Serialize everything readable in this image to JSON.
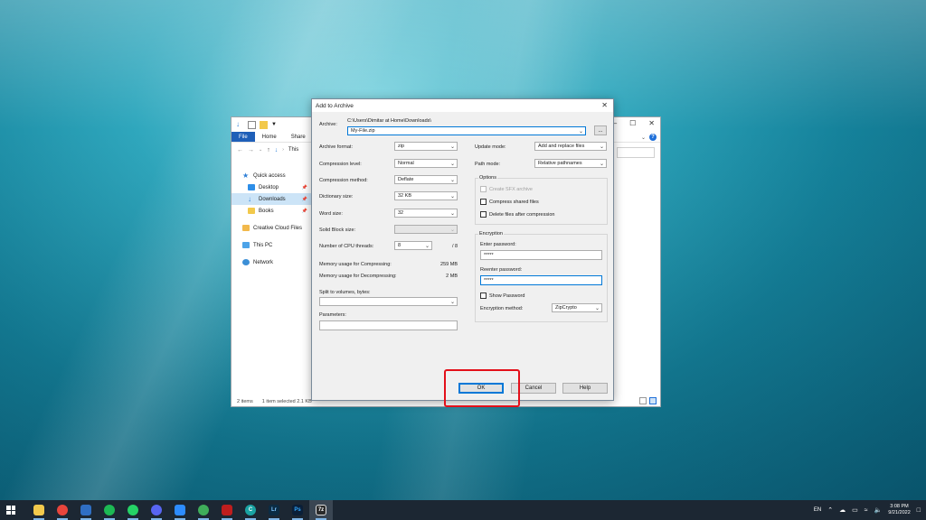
{
  "explorer": {
    "ribbon_tabs": [
      "File",
      "Home",
      "Share"
    ],
    "address": "This",
    "nav": [
      {
        "label": "Quick access",
        "icon": "star-icon",
        "sub": false,
        "pinned": false,
        "selected": false
      },
      {
        "label": "Desktop",
        "icon": "desktop-icon",
        "sub": true,
        "pinned": true,
        "selected": false
      },
      {
        "label": "Downloads",
        "icon": "download-icon",
        "sub": true,
        "pinned": true,
        "selected": true
      },
      {
        "label": "Books",
        "icon": "folder-icon",
        "sub": true,
        "pinned": true,
        "selected": false
      },
      {
        "label": "Creative Cloud Files",
        "icon": "creative-cloud-icon",
        "sub": false,
        "pinned": false,
        "selected": false
      },
      {
        "label": "This PC",
        "icon": "computer-icon",
        "sub": false,
        "pinned": false,
        "selected": false
      },
      {
        "label": "Network",
        "icon": "network-icon",
        "sub": false,
        "pinned": false,
        "selected": false
      }
    ],
    "status_items": "2 items",
    "status_selected": "1 item selected  2.1 KB"
  },
  "dialog": {
    "title": "Add to Archive",
    "archive_label": "Archive:",
    "archive_path": "C:\\Users\\Dimitar at Home\\Downloads\\",
    "archive_name": "My-File.zip",
    "browse_label": "...",
    "left": {
      "archive_format": {
        "label": "Archive format:",
        "value": "zip"
      },
      "compression_level": {
        "label": "Compression level:",
        "value": "Normal"
      },
      "compression_method": {
        "label": "Compression method:",
        "value": "Deflate"
      },
      "dictionary_size": {
        "label": "Dictionary size:",
        "value": "32 KB"
      },
      "word_size": {
        "label": "Word size:",
        "value": "32"
      },
      "solid_block": {
        "label": "Solid Block size:",
        "value": ""
      },
      "cpu_threads": {
        "label": "Number of CPU threads:",
        "value": "8",
        "max": "/ 8"
      },
      "mem_compress": {
        "label": "Memory usage for Compressing:",
        "value": "259 MB"
      },
      "mem_decompress": {
        "label": "Memory usage for Decompressing:",
        "value": "2 MB"
      },
      "split_label": "Split to volumes, bytes:",
      "params_label": "Parameters:"
    },
    "right": {
      "update_mode": {
        "label": "Update mode:",
        "value": "Add and replace files"
      },
      "path_mode": {
        "label": "Path mode:",
        "value": "Relative pathnames"
      },
      "options_label": "Options",
      "sfx_label": "Create SFX archive",
      "shared_label": "Compress shared files",
      "delete_label": "Delete files after compression",
      "encryption_label": "Encryption",
      "enter_password_label": "Enter password:",
      "enter_password_value": "*****",
      "reenter_password_label": "Reenter password:",
      "reenter_password_value": "*****",
      "show_password_label": "Show Password",
      "enc_method": {
        "label": "Encryption method:",
        "value": "ZipCrypto"
      }
    },
    "buttons": {
      "ok": "OK",
      "cancel": "Cancel",
      "help": "Help"
    }
  },
  "taskbar": {
    "apps": [
      {
        "name": "file-explorer-icon",
        "glyph": "",
        "color": "#f2c94c"
      },
      {
        "name": "chrome-icon",
        "glyph": "",
        "color": "#e8453c"
      },
      {
        "name": "onedrive-app-icon",
        "glyph": "",
        "color": "#2f6fc4"
      },
      {
        "name": "spotify-icon",
        "glyph": "",
        "color": "#1db954"
      },
      {
        "name": "whatsapp-icon",
        "glyph": "",
        "color": "#25d366"
      },
      {
        "name": "discord-icon",
        "glyph": "",
        "color": "#5865f2"
      },
      {
        "name": "zoom-icon",
        "glyph": "",
        "color": "#2d8cff"
      },
      {
        "name": "spotify-alt-icon",
        "glyph": "",
        "color": "#3fae5a"
      },
      {
        "name": "filezilla-icon",
        "glyph": "",
        "color": "#bf1e1e"
      },
      {
        "name": "edge-icon",
        "glyph": "C",
        "color": "#1aa3a3"
      },
      {
        "name": "lightroom-icon",
        "glyph": "Lr",
        "color": "#0b2c44"
      },
      {
        "name": "photoshop-icon",
        "glyph": "Ps",
        "color": "#0a1f38"
      },
      {
        "name": "7zip-icon",
        "glyph": "7z",
        "color": "#2b2b2b"
      }
    ],
    "lang": "EN",
    "time": "3:08 PM",
    "date": "9/21/2022"
  }
}
